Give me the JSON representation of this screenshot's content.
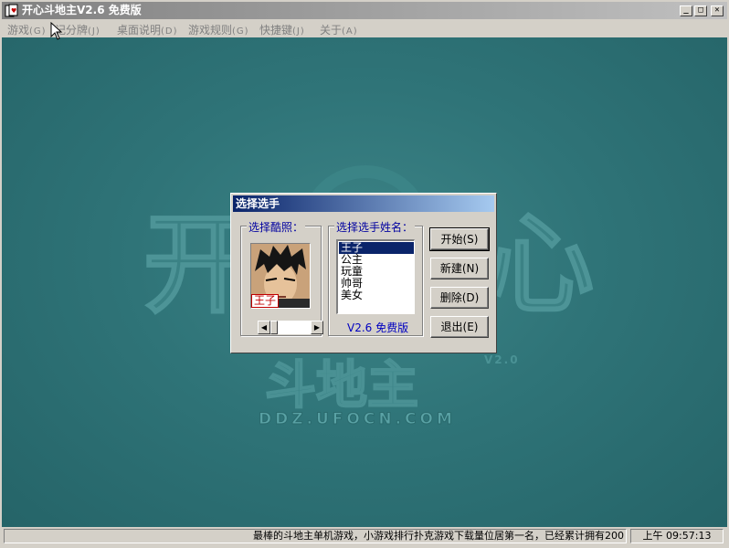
{
  "window": {
    "title": "开心斗地主V2.6 免费版",
    "minimize_glyph": "_",
    "maximize_glyph": "□",
    "close_glyph": "✕"
  },
  "menu": [
    {
      "label": "游戏",
      "accel": "(G)"
    },
    {
      "label": "记分牌",
      "accel": "(J)"
    },
    {
      "label": "桌面说明",
      "accel": "(D)"
    },
    {
      "label": "游戏规则",
      "accel": "(G)"
    },
    {
      "label": "快捷键",
      "accel": "(J)"
    },
    {
      "label": "关于",
      "accel": "(A)"
    }
  ],
  "background": {
    "logo_left": "开",
    "logo_right": "心",
    "logo_bottom": "斗地主",
    "version_tag": "V2.0",
    "url": "DDZ.UFOCN.COM"
  },
  "dialog": {
    "title": "选择选手",
    "photo_group_label": "选择酷照：",
    "avatar_name": "王子",
    "name_group_label": "选择选手姓名：",
    "players": [
      "王子",
      "公主",
      "玩童",
      "帅哥",
      "美女"
    ],
    "selected_index": 0,
    "version_label": "V2.6 免费版",
    "buttons": {
      "start": "开始(S)",
      "new": "新建(N)",
      "delete": "删除(D)",
      "exit": "退出(E)"
    }
  },
  "status": {
    "message": "最棒的斗地主单机游戏，小游戏排行扑克游戏下载量位居第一名，已经累计拥有200",
    "time": "上午 09:57:13"
  },
  "colors": {
    "desktop_teal": "#2f7478",
    "title_active": "#0a246a",
    "title_inactive": "#808080",
    "group_label": "#0000a0",
    "version_text": "#0000c0"
  }
}
